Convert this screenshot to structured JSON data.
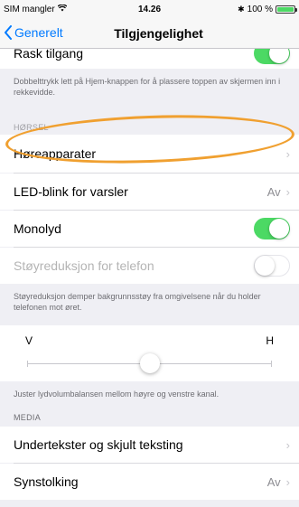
{
  "status": {
    "carrier": "SIM mangler",
    "time": "14.26",
    "battery": "100 %"
  },
  "nav": {
    "back_label": "Generelt",
    "title": "Tilgjengelighet"
  },
  "top_row": {
    "label": "Rask tilgang"
  },
  "top_footer": "Dobbelttrykk lett på Hjem-knappen for å plassere toppen av skjermen inn i rekkevidde.",
  "hearing": {
    "header": "HØRSEL",
    "rows": [
      {
        "label": "Høreapparater",
        "value": ""
      },
      {
        "label": "LED-blink for varsler",
        "value": "Av"
      },
      {
        "label": "Monolyd",
        "toggle": "on"
      },
      {
        "label": "Støyreduksjon for telefon",
        "toggle": "off"
      }
    ],
    "footer": "Støyreduksjon demper bakgrunnsstøy fra omgivelsene når du holder telefonen mot øret."
  },
  "balance": {
    "left": "V",
    "right": "H",
    "value": 0.5,
    "footer": "Juster lydvolumbalansen mellom høyre og venstre kanal."
  },
  "media": {
    "header": "MEDIA",
    "rows": [
      {
        "label": "Undertekster og skjult teksting",
        "value": ""
      },
      {
        "label": "Synstolking",
        "value": "Av"
      }
    ]
  },
  "colors": {
    "accent": "#007aff",
    "toggle_on": "#4cd964",
    "annotation": "#f0a030"
  }
}
